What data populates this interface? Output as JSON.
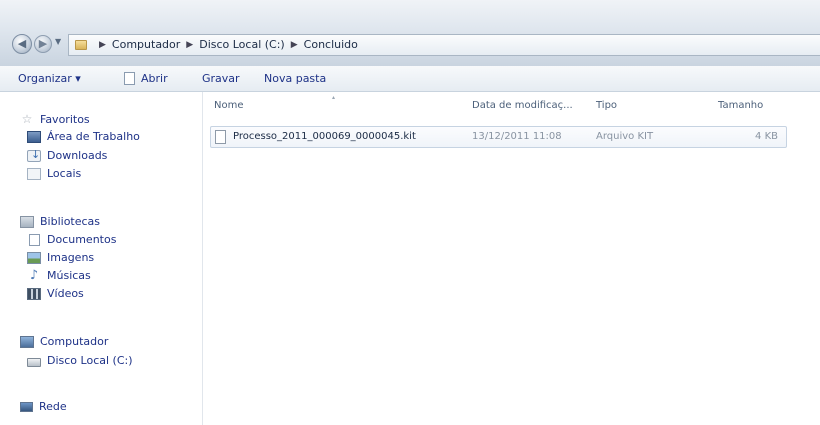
{
  "address": {
    "breadcrumbs": [
      "Computador",
      "Disco Local (C:)",
      "Concluido"
    ]
  },
  "toolbar": {
    "organize_label": "Organizar ▾",
    "open_label": "Abrir",
    "burn_label": "Gravar",
    "new_folder_label": "Nova pasta"
  },
  "nav": {
    "favorites": {
      "label": "Favoritos",
      "items": [
        "Área de Trabalho",
        "Downloads",
        "Locais"
      ]
    },
    "libraries": {
      "label": "Bibliotecas",
      "items": [
        "Documentos",
        "Imagens",
        "Músicas",
        "Vídeos"
      ]
    },
    "computer": {
      "label": "Computador",
      "items": [
        "Disco Local (C:)"
      ]
    },
    "network": {
      "label": "Rede"
    }
  },
  "columns": {
    "name": "Nome",
    "date": "Data de modificaç...",
    "type": "Tipo",
    "size": "Tamanho"
  },
  "files": [
    {
      "name": "Processo_2011_000069_0000045.kit",
      "date": "13/12/2011 11:08",
      "type": "Arquivo KIT",
      "size": "4 KB"
    }
  ]
}
